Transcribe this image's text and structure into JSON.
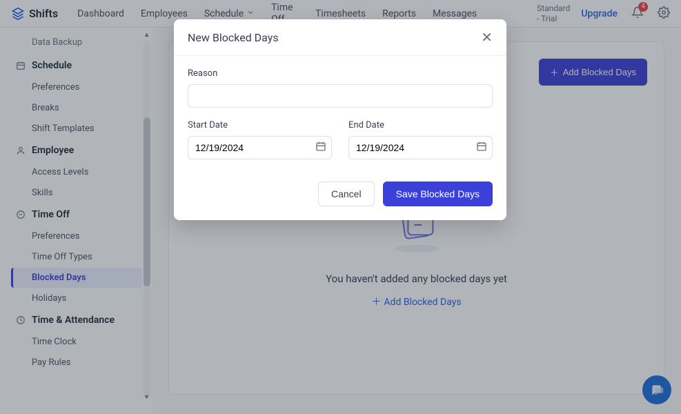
{
  "brand": "Shifts",
  "nav": {
    "items": [
      "Dashboard",
      "Employees",
      "Schedule",
      "Time Off",
      "Timesheets",
      "Reports",
      "Messages"
    ],
    "plan_line1": "Standard",
    "plan_line2": "- Trial",
    "upgrade": "Upgrade",
    "notif_count": "4"
  },
  "sidebar": {
    "partial_item": "Data Backup",
    "groups": [
      {
        "title": "Schedule",
        "items": [
          "Preferences",
          "Breaks",
          "Shift Templates"
        ]
      },
      {
        "title": "Employee",
        "items": [
          "Access Levels",
          "Skills"
        ]
      },
      {
        "title": "Time Off",
        "items": [
          "Preferences",
          "Time Off Types",
          "Blocked Days",
          "Holidays"
        ]
      },
      {
        "title": "Time & Attendance",
        "items": [
          "Time Clock",
          "Pay Rules"
        ]
      }
    ],
    "active": "Blocked Days"
  },
  "page": {
    "add_button": "Add Blocked Days",
    "empty_title": "You haven't added any blocked days yet",
    "empty_link": "Add Blocked Days"
  },
  "modal": {
    "title": "New Blocked Days",
    "reason_label": "Reason",
    "reason_value": "",
    "start_label": "Start Date",
    "start_value": "12/19/2024",
    "end_label": "End Date",
    "end_value": "12/19/2024",
    "cancel": "Cancel",
    "save": "Save Blocked Days"
  }
}
